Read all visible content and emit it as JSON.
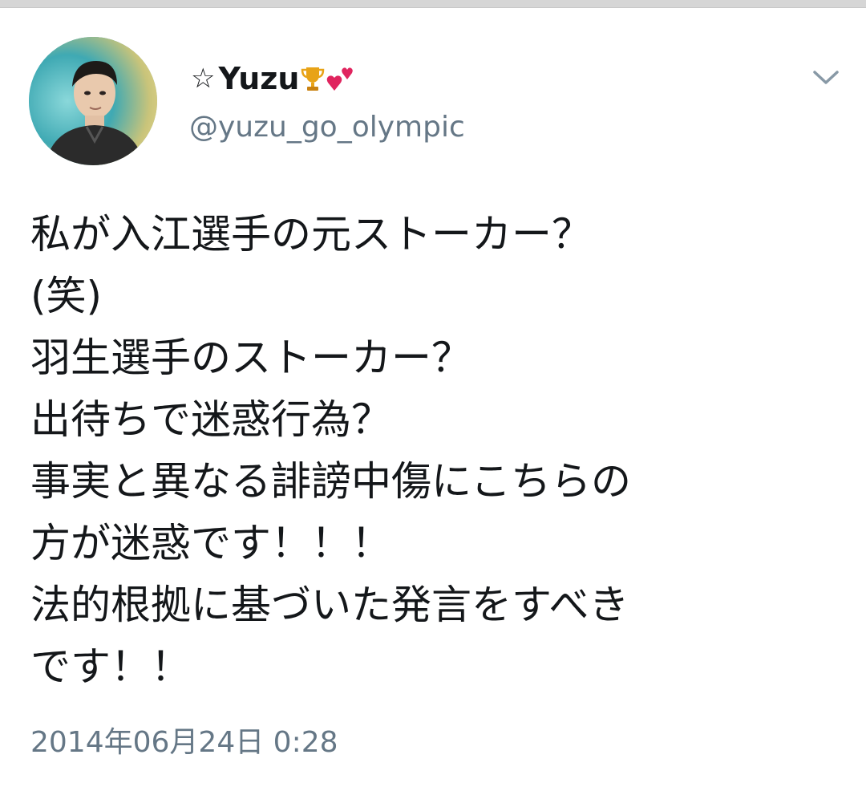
{
  "tweet": {
    "author": {
      "display_prefix": "☆",
      "display_name": "Yuzu",
      "name_decorations": [
        "trophy-icon",
        "hearts-icon"
      ],
      "handle": "@yuzu_go_olympic"
    },
    "menu_icon": "chevron-down-icon",
    "body_lines": [
      "私が入江選手の元ストーカー？",
      "(笑)",
      "羽生選手のストーカー？",
      "出待ちで迷惑行為？",
      "事実と異なる誹謗中傷にこちらの",
      "方が迷惑です！！！",
      "法的根拠に基づいた発言をすべき",
      "です！！"
    ],
    "timestamp": "2014年06月24日 0:28"
  },
  "colors": {
    "text_primary": "#14171a",
    "text_secondary": "#657786",
    "trophy": "#e8a317",
    "heart": "#e0245e"
  }
}
